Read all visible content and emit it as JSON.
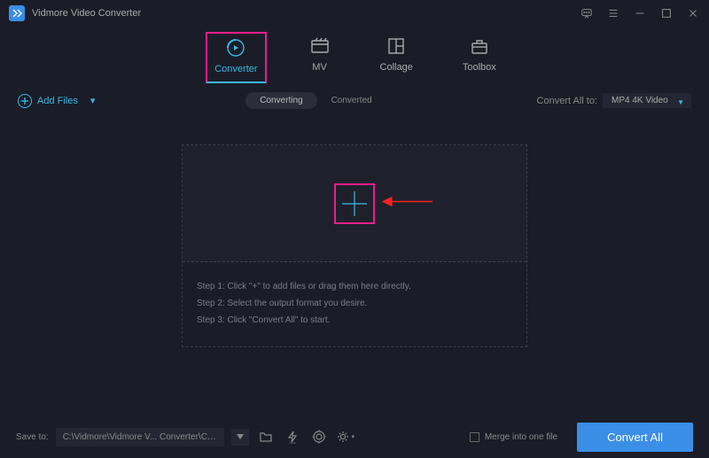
{
  "app": {
    "title": "Vidmore Video Converter"
  },
  "mainTabs": [
    {
      "label": "Converter",
      "active": true
    },
    {
      "label": "MV"
    },
    {
      "label": "Collage"
    },
    {
      "label": "Toolbox"
    }
  ],
  "toolbar": {
    "addFiles": "Add Files",
    "subTabs": {
      "converting": "Converting",
      "converted": "Converted"
    },
    "convertAllTo": "Convert All to:",
    "format": "MP4 4K Video"
  },
  "drop": {
    "step1": "Step 1: Click \"+\" to add files or drag them here directly.",
    "step2": "Step 2: Select the output format you desire.",
    "step3": "Step 3: Click \"Convert All\" to start."
  },
  "footer": {
    "saveTo": "Save to:",
    "path": "C:\\Vidmore\\Vidmore V... Converter\\Converted",
    "merge": "Merge into one file",
    "convertAll": "Convert All"
  }
}
